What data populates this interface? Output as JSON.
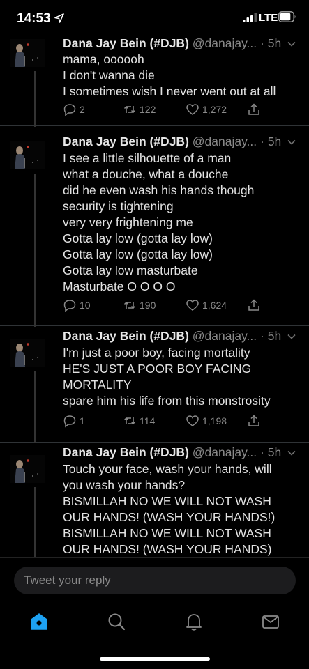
{
  "status_bar": {
    "time": "14:53",
    "network": "LTE"
  },
  "colors": {
    "accent": "#1da1f2",
    "background": "#000000",
    "text": "#e2e2e2",
    "secondary_text": "#8a8a8a"
  },
  "tweets": [
    {
      "name": "Dana Jay Bein (#DJB)",
      "handle": "@danajay...",
      "dot": "·",
      "time": "5h",
      "lines": [
        "mama, oooooh",
        "I don't wanna die",
        "I sometimes wish I never went out at all"
      ],
      "replies": "2",
      "retweets": "122",
      "likes": "1,272"
    },
    {
      "name": "Dana Jay Bein (#DJB)",
      "handle": "@danajay...",
      "dot": "·",
      "time": "5h",
      "lines": [
        "I see a little silhouette of a man",
        "what a douche, what a douche",
        "did he even wash his hands though",
        "security is tightening",
        "very very frightening me",
        "Gotta lay low (gotta lay low)",
        "Gotta lay low (gotta lay low)",
        "Gotta lay low masturbate",
        "Masturbate O O O O"
      ],
      "replies": "10",
      "retweets": "190",
      "likes": "1,624"
    },
    {
      "name": "Dana Jay Bein (#DJB)",
      "handle": "@danajay...",
      "dot": "·",
      "time": "5h",
      "lines": [
        "I'm just a poor boy, facing mortality",
        "HE'S JUST A POOR BOY FACING",
        "MORTALITY",
        "spare him his life from this monstrosity"
      ],
      "replies": "1",
      "retweets": "114",
      "likes": "1,198"
    },
    {
      "name": "Dana Jay Bein (#DJB)",
      "handle": "@danajay...",
      "dot": "·",
      "time": "5h",
      "lines": [
        "Touch your face, wash your hands, will",
        "you wash your hands?",
        "BISMILLAH NO WE WILL NOT WASH",
        "OUR HANDS! (WASH YOUR HANDS!)",
        "BISMILLAH NO WE WILL NOT WASH",
        "OUR HANDS! (WASH YOUR HANDS)"
      ]
    }
  ],
  "reply_bar": {
    "placeholder": "Tweet your reply"
  },
  "tab_bar": {
    "icons": [
      "home-icon",
      "search-icon",
      "notifications-bell-icon",
      "messages-mail-icon"
    ]
  }
}
